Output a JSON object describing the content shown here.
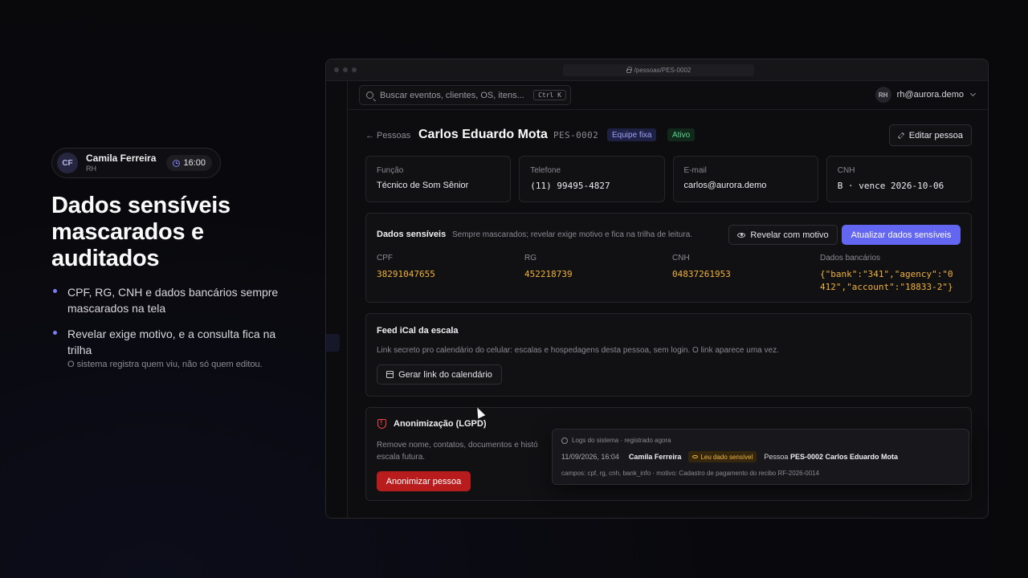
{
  "presenter": {
    "initials": "CF",
    "name": "Camila Ferreira",
    "role": "RH",
    "time": "16:00"
  },
  "headline": "Dados sensíveis mascarados e auditados",
  "bullets": [
    {
      "text": "CPF, RG, CNH e dados bancários sempre mascarados na tela",
      "sub": ""
    },
    {
      "text": "Revelar exige motivo, e a consulta fica na trilha",
      "sub": "O sistema registra quem viu, não só quem editou."
    }
  ],
  "window": {
    "url": "/pessoas/PES-0002",
    "search_placeholder": "Buscar eventos, clientes, OS, itens...",
    "search_shortcut": "Ctrl K",
    "account_initials": "RH",
    "account_email": "rh@aurora.demo"
  },
  "person": {
    "back_label": "← Pessoas",
    "name": "Carlos Eduardo Mota",
    "id": "PES-0002",
    "badge_team": "Equipe fixa",
    "badge_status": "Ativo",
    "edit_label": "Editar pessoa",
    "info": [
      {
        "label": "Função",
        "value": "Técnico de Som Sênior"
      },
      {
        "label": "Telefone",
        "value": "(11) 99495-4827"
      },
      {
        "label": "E-mail",
        "value": "carlos@aurora.demo"
      },
      {
        "label": "CNH",
        "value": "B · vence 2026-10-06"
      }
    ]
  },
  "sensitive": {
    "title": "Dados sensíveis",
    "subtitle": "Sempre mascarados; revelar exige motivo e fica na trilha de leitura.",
    "reveal_label": "Revelar com motivo",
    "update_label": "Atualizar dados sensíveis",
    "fields": [
      {
        "label": "CPF",
        "value": "38291047655"
      },
      {
        "label": "RG",
        "value": "452218739"
      },
      {
        "label": "CNH",
        "value": "04837261953"
      },
      {
        "label": "Dados bancários",
        "value": "{\"bank\":\"341\",\"agency\":\"0412\",\"account\":\"18833-2\"}"
      }
    ]
  },
  "ical": {
    "title": "Feed iCal da escala",
    "description": "Link secreto pro calendário do celular: escalas e hospedagens desta pessoa, sem login. O link aparece uma vez.",
    "button_label": "Gerar link do calendário"
  },
  "anon": {
    "title": "Anonimização (LGPD)",
    "description": "Remove nome, contatos, documentos e histó escala futura.",
    "button_label": "Anonimizar pessoa"
  },
  "toast": {
    "header": "Logs do sistema · registrado agora",
    "time": "11/09/2026, 16:04",
    "user": "Camila Ferreira",
    "badge": "Leu dado sensível",
    "target_prefix": "Pessoa",
    "target": "PES-0002 Carlos Eduardo Mota",
    "details": "campos: cpf, rg, cnh, bank_info · motivo: Cadastro de pagamento do recibo RF-2026-0014"
  },
  "colors": {
    "accent": "#6366f1",
    "masked_value": "#f2b23a",
    "danger": "#b91c1c",
    "success": "#5ed48e"
  }
}
